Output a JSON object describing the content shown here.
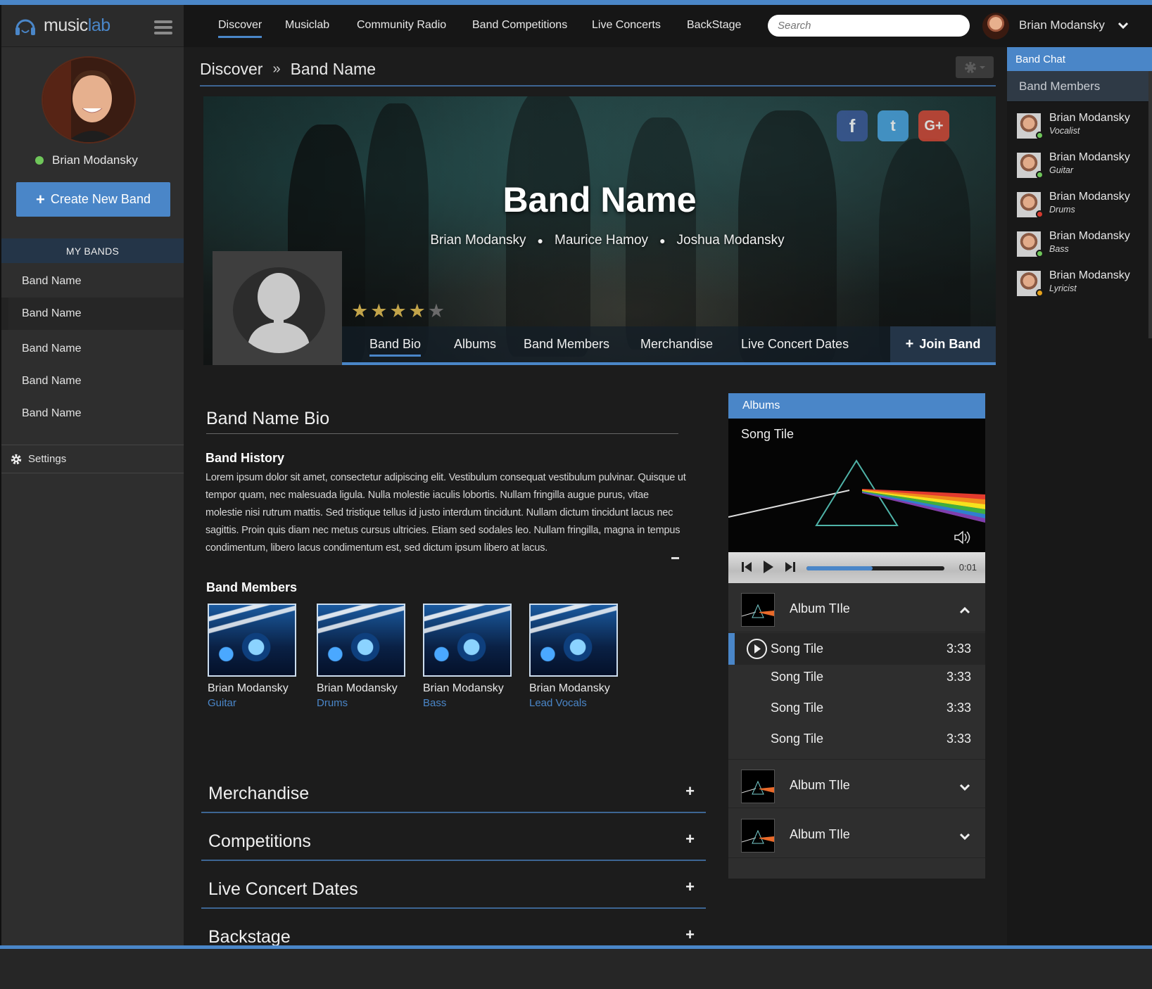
{
  "app": {
    "logo_main": "music",
    "logo_accent": "lab",
    "accent_color": "#4a86c8",
    "online_color": "#6fc65a"
  },
  "sidebar": {
    "user_name": "Brian Modansky",
    "create_button": "Create New Band",
    "my_bands_heading": "MY BANDS",
    "bands": [
      "Band Name",
      "Band Name",
      "Band Name",
      "Band Name",
      "Band Name"
    ],
    "settings_label": "Settings"
  },
  "topnav": {
    "items": [
      "Discover",
      "Musiclab",
      "Community Radio",
      "Band Competitions",
      "Live Concerts",
      "BackStage"
    ],
    "active": "Discover",
    "search_placeholder": "Search",
    "user_name": "Brian Modansky"
  },
  "breadcrumb": {
    "root": "Discover",
    "separator": "»",
    "current": "Band Name"
  },
  "hero": {
    "band_name": "Band Name",
    "members": [
      "Brian Modansky",
      "Maurice Hamoy",
      "Joshua Modansky"
    ],
    "rating": 4,
    "rating_max": 5,
    "social": [
      "facebook-icon",
      "twitter-icon",
      "google-plus-icon"
    ],
    "tabs": [
      "Band Bio",
      "Albums",
      "Band Members",
      "Merchandise",
      "Live Concert Dates"
    ],
    "active_tab": "Band Bio",
    "join_label": "Join Band"
  },
  "bio": {
    "title": "Band Name Bio",
    "history_heading": "Band History",
    "history_text": "Lorem ipsum dolor sit amet, consectetur adipiscing elit. Vestibulum consequat vestibulum pulvinar. Quisque ut tempor quam, nec malesuada ligula. Nulla molestie iaculis lobortis. Nullam fringilla augue purus, vitae molestie nisi rutrum mattis. Sed tristique tellus id justo interdum tincidunt. Nullam dictum tincidunt lacus nec sagittis. Proin quis diam nec metus cursus ultricies. Etiam sed sodales leo. Nullam fringilla, magna in tempus condimentum, libero lacus condimentum est, sed dictum ipsum libero at lacus.",
    "members_heading": "Band Members",
    "members": [
      {
        "name": "Brian Modansky",
        "role": "Guitar"
      },
      {
        "name": "Brian Modansky",
        "role": "Drums"
      },
      {
        "name": "Brian Modansky",
        "role": "Bass"
      },
      {
        "name": "Brian Modansky",
        "role": "Lead Vocals"
      }
    ]
  },
  "sections": [
    "Merchandise",
    "Competitions",
    "Live Concert Dates",
    "Backstage"
  ],
  "albums_panel": {
    "heading": "Albums",
    "now_playing": "Song Tile",
    "elapsed": "0:01",
    "progress": 0.48,
    "albums": [
      {
        "title": "Album TIle",
        "expanded": true,
        "songs": [
          {
            "title": "Song Tile",
            "duration": "3:33"
          },
          {
            "title": "Song Tile",
            "duration": "3:33"
          },
          {
            "title": "Song Tile",
            "duration": "3:33"
          },
          {
            "title": "Song Tile",
            "duration": "3:33"
          }
        ]
      },
      {
        "title": "Album TIle",
        "expanded": false
      },
      {
        "title": "Album TIle",
        "expanded": false
      }
    ]
  },
  "band_chat": {
    "heading": "Band Chat",
    "subheading": "Band Members",
    "members": [
      {
        "name": "Brian Modansky",
        "role": "Vocalist",
        "status_color": "#6fc65a"
      },
      {
        "name": "Brian Modansky",
        "role": "Guitar",
        "status_color": "#6fc65a"
      },
      {
        "name": "Brian Modansky",
        "role": "Drums",
        "status_color": "#d43a2f"
      },
      {
        "name": "Brian Modansky",
        "role": "Bass",
        "status_color": "#6fc65a"
      },
      {
        "name": "Brian Modansky",
        "role": "Lyricist",
        "status_color": "#e6a21c"
      }
    ]
  }
}
